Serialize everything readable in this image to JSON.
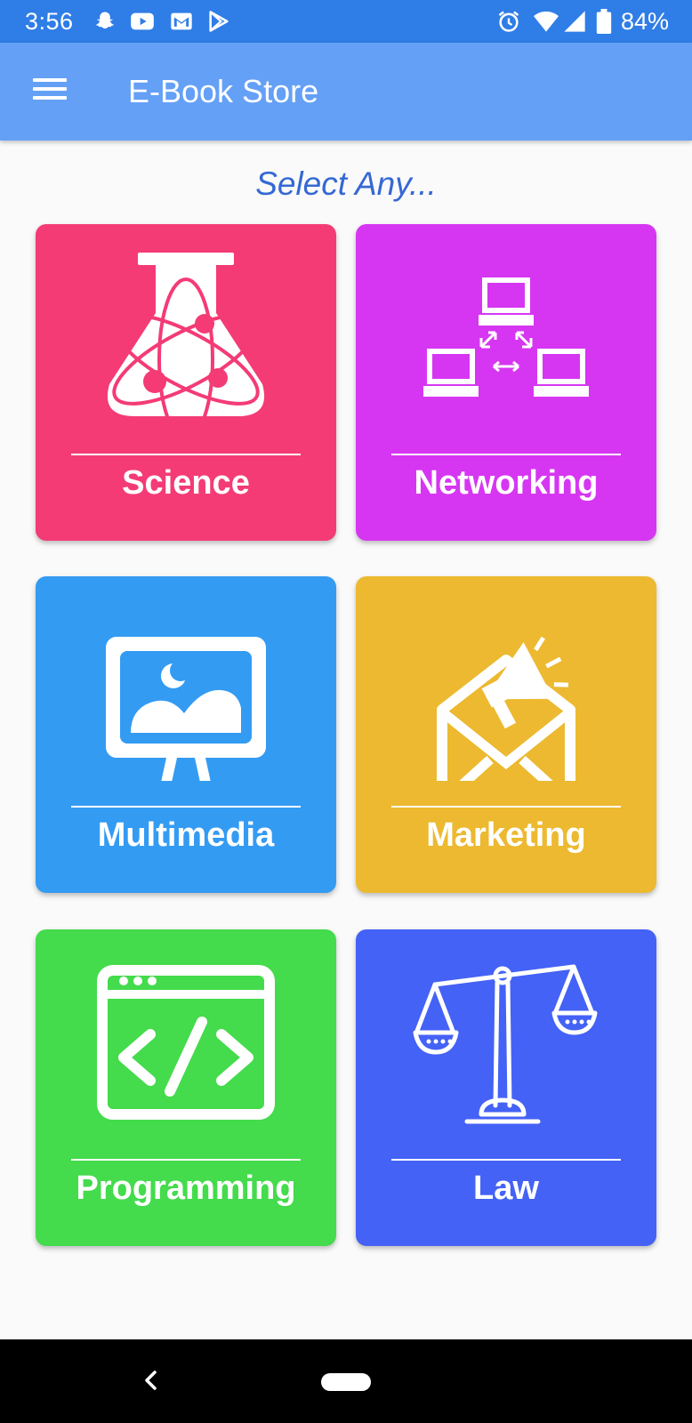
{
  "status_bar": {
    "time": "3:56",
    "battery": "84%",
    "left_icons": [
      "snapchat-icon",
      "youtube-icon",
      "gmail-icon",
      "play-store-icon"
    ],
    "right_icons": [
      "alarm-icon",
      "wifi-icon",
      "signal-icon",
      "battery-icon"
    ]
  },
  "app_bar": {
    "title": "E-Book Store",
    "menu_icon": "hamburger-menu-icon"
  },
  "heading": "Select Any...",
  "categories": [
    {
      "label": "Science",
      "color": "#f43b76",
      "icon": "science-flask-icon"
    },
    {
      "label": "Networking",
      "color": "#d636f2",
      "icon": "network-computers-icon"
    },
    {
      "label": "Multimedia",
      "color": "#349bf3",
      "icon": "multimedia-presentation-icon"
    },
    {
      "label": "Marketing",
      "color": "#ecb930",
      "icon": "marketing-megaphone-icon"
    },
    {
      "label": "Programming",
      "color": "#44db4c",
      "icon": "code-window-icon"
    },
    {
      "label": "Law",
      "color": "#4462f6",
      "icon": "law-scales-icon"
    }
  ],
  "colors": {
    "status_bar": "#2f7de6",
    "app_bar": "#64a0f6",
    "heading": "#3568d4"
  }
}
